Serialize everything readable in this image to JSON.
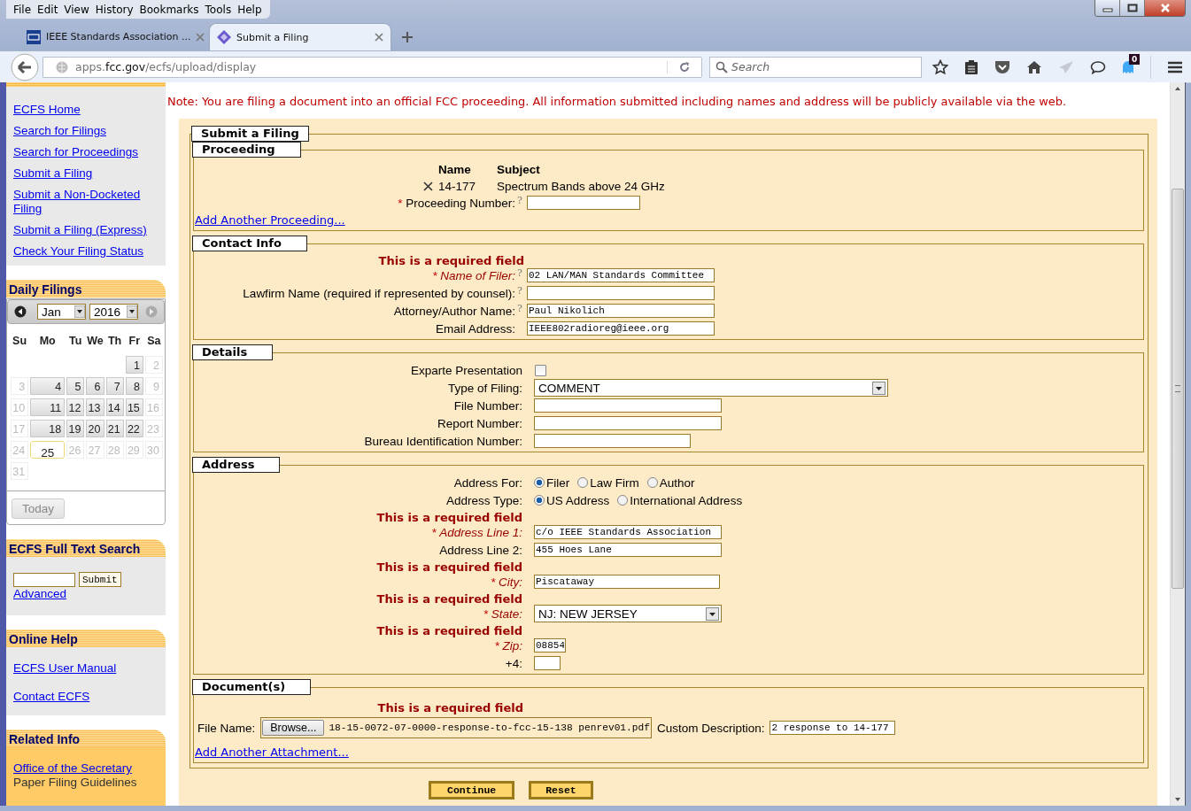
{
  "browser": {
    "menu": [
      "File",
      "Edit",
      "View",
      "History",
      "Bookmarks",
      "Tools",
      "Help"
    ],
    "tabs": [
      {
        "label": "IEEE Standards Association ...",
        "selected": false
      },
      {
        "label": "Submit a Filing",
        "selected": true
      }
    ],
    "url_parts": [
      {
        "text": "apps.",
        "strong": false
      },
      {
        "text": "fcc.gov",
        "strong": true
      },
      {
        "text": "/ecfs/upload/display",
        "strong": false
      }
    ],
    "search_placeholder": "Search",
    "badge": "0"
  },
  "sidebar": {
    "main_links": [
      "ECFS Home",
      "Search for Filings",
      "Search for Proceedings",
      "Submit a Filing",
      "Submit a Non-Docketed Filing",
      "Submit a Filing (Express)",
      "Check Your Filing Status"
    ],
    "daily_filings": {
      "title": "Daily Filings",
      "month": "Jan",
      "year": "2016",
      "weekdays": [
        "Su",
        "Mo",
        "Tu",
        "We",
        "Th",
        "Fr",
        "Sa"
      ],
      "weeks": [
        [
          {
            "kind": "blank"
          },
          {
            "kind": "blank"
          },
          {
            "kind": "blank"
          },
          {
            "kind": "blank"
          },
          {
            "kind": "blank"
          },
          {
            "day": "1",
            "kind": "filing"
          },
          {
            "day": "2",
            "kind": "other"
          }
        ],
        [
          {
            "day": "3",
            "kind": "other"
          },
          {
            "day": "4",
            "kind": "filing"
          },
          {
            "day": "5",
            "kind": "filing"
          },
          {
            "day": "6",
            "kind": "filing"
          },
          {
            "day": "7",
            "kind": "filing"
          },
          {
            "day": "8",
            "kind": "filing"
          },
          {
            "day": "9",
            "kind": "other"
          }
        ],
        [
          {
            "day": "10",
            "kind": "other"
          },
          {
            "day": "11",
            "kind": "filing"
          },
          {
            "day": "12",
            "kind": "filing"
          },
          {
            "day": "13",
            "kind": "filing"
          },
          {
            "day": "14",
            "kind": "filing"
          },
          {
            "day": "15",
            "kind": "filing"
          },
          {
            "day": "16",
            "kind": "other"
          }
        ],
        [
          {
            "day": "17",
            "kind": "other"
          },
          {
            "day": "18",
            "kind": "filing"
          },
          {
            "day": "19",
            "kind": "filing"
          },
          {
            "day": "20",
            "kind": "filing"
          },
          {
            "day": "21",
            "kind": "filing"
          },
          {
            "day": "22",
            "kind": "filing"
          },
          {
            "day": "23",
            "kind": "other"
          }
        ],
        [
          {
            "day": "24",
            "kind": "other"
          },
          {
            "day": "25",
            "kind": "today"
          },
          {
            "day": "26",
            "kind": "other"
          },
          {
            "day": "27",
            "kind": "other"
          },
          {
            "day": "28",
            "kind": "other"
          },
          {
            "day": "29",
            "kind": "other"
          },
          {
            "day": "30",
            "kind": "other"
          }
        ],
        [
          {
            "day": "31",
            "kind": "other"
          }
        ]
      ],
      "today_button": "Today"
    },
    "full_text_search": {
      "title": "ECFS Full Text Search",
      "button": "Submit",
      "link": "Advanced"
    },
    "online_help": {
      "title": "Online Help",
      "links": [
        "ECFS User Manual",
        "Contact ECFS"
      ]
    },
    "related_info": {
      "title": "Related Info",
      "link": "Office of the Secretary",
      "text": "Paper Filing Guidelines"
    }
  },
  "main": {
    "note": "Note: You are filing a document into an official FCC proceeding. All information submitted including names and address will be publicly available via the web.",
    "form_title": "Submit a Filing",
    "proceeding": {
      "title": "Proceeding",
      "columns": [
        "Name",
        "Subject"
      ],
      "rows": [
        {
          "name": "14-177",
          "subject": "Spectrum Bands above 24 GHz"
        }
      ],
      "field": {
        "kind": "text",
        "marker": "*",
        "label": "Proceeding Number:",
        "required": false,
        "help": "?"
      },
      "add_link": "Add Another Proceeding..."
    },
    "contact": {
      "title": "Contact Info",
      "fields": [
        {
          "kind": "text",
          "error": "This is a required field",
          "marker": "*",
          "label": "Name of Filer:",
          "required": true,
          "help": "?",
          "value": "02 LAN/MAN Standards Committee"
        },
        {
          "kind": "text",
          "label": "Lawfirm Name (required if represented by counsel):",
          "required": false,
          "help": "?"
        },
        {
          "kind": "text",
          "label": "Attorney/Author Name:",
          "required": false,
          "help": "?",
          "value": "Paul Nikolich"
        },
        {
          "kind": "text",
          "label": "Email Address:",
          "required": false,
          "value": "IEEE802radioreg@ieee.org"
        }
      ]
    },
    "details": {
      "title": "Details",
      "fields": [
        {
          "kind": "checkbox",
          "label": "Exparte Presentation",
          "required": false,
          "checked": false
        },
        {
          "kind": "select",
          "label": "Type of Filing:",
          "required": false,
          "value": "COMMENT"
        },
        {
          "kind": "text",
          "label": "File Number:",
          "required": false
        },
        {
          "kind": "text",
          "label": "Report Number:",
          "required": false
        },
        {
          "kind": "text",
          "label": "Bureau Identification Number:",
          "required": false
        }
      ]
    },
    "address": {
      "title": "Address",
      "fields": [
        {
          "kind": "radio",
          "label": "Address For:",
          "required": false,
          "options": [
            {
              "label": "Filer",
              "selected": true
            },
            {
              "label": "Law Firm",
              "selected": false
            },
            {
              "label": "Author",
              "selected": false
            }
          ]
        },
        {
          "kind": "radio",
          "label": "Address Type:",
          "required": false,
          "options": [
            {
              "label": "US Address",
              "selected": true
            },
            {
              "label": "International Address",
              "selected": false
            }
          ]
        },
        {
          "kind": "text",
          "error": "This is a required field",
          "marker": "*",
          "label": "Address Line 1:",
          "required": true,
          "value": "c/o IEEE Standards Association"
        },
        {
          "kind": "text",
          "label": "Address Line 2:",
          "required": false,
          "value": "455 Hoes Lane"
        },
        {
          "kind": "text",
          "error": "This is a required field",
          "marker": "*",
          "label": "City:",
          "required": true,
          "value": "Piscataway"
        },
        {
          "kind": "select",
          "error": "This is a required field",
          "marker": "*",
          "label": "State:",
          "required": true,
          "value": "NJ: NEW JERSEY"
        },
        {
          "kind": "text",
          "error": "This is a required field",
          "marker": "*",
          "label": "Zip:",
          "required": true,
          "value": "08854"
        },
        {
          "kind": "text",
          "label": "+4:",
          "required": false
        }
      ]
    },
    "documents": {
      "title": "Document(s)",
      "error": "This is a required field",
      "file_label": "File Name:",
      "browse": "Browse...",
      "file": "18-15-0072-07-0000-response-to-fcc-15-138 penrev01.pdf",
      "description_label": "Custom Description:",
      "description": "2 response to 14-177",
      "add_link": "Add Another Attachment..."
    },
    "buttons": [
      "Continue",
      "Reset"
    ]
  }
}
